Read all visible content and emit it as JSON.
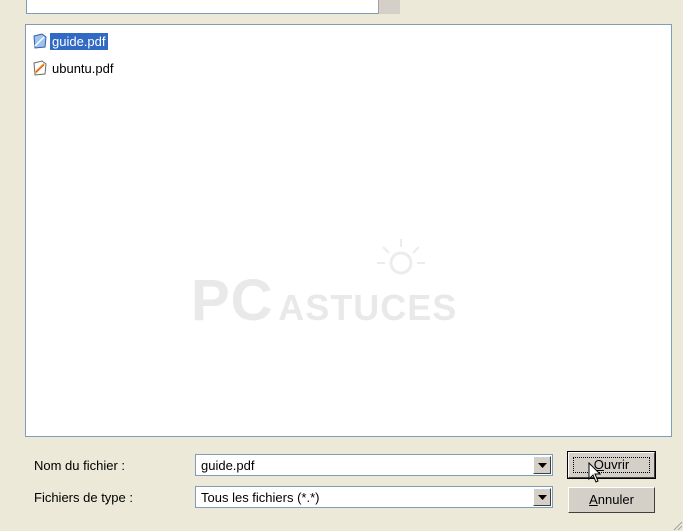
{
  "files": [
    {
      "name": "guide.pdf",
      "selected": true,
      "icon": "pdf-file-icon"
    },
    {
      "name": "ubuntu.pdf",
      "selected": false,
      "icon": "pdf-file-icon"
    }
  ],
  "watermark": {
    "part1": "PC",
    "part2": "ASTUCES"
  },
  "filename_row": {
    "label": "Nom du fichier :",
    "value": "guide.pdf"
  },
  "filetype_row": {
    "label": "Fichiers de type :",
    "value": "Tous les fichiers (*.*)"
  },
  "buttons": {
    "open": {
      "accel": "O",
      "rest": "uvrir"
    },
    "cancel": {
      "accel": "A",
      "rest": "nnuler"
    }
  }
}
